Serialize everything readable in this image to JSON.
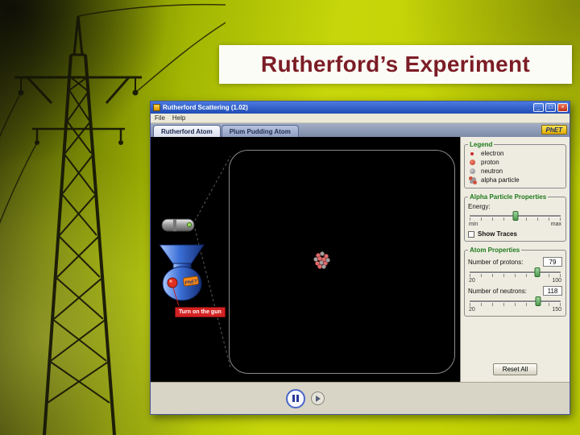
{
  "slide": {
    "title": "Rutherford’s Experiment"
  },
  "window": {
    "title": "Rutherford Scattering (1.02)",
    "controls": {
      "minimize": "_",
      "maximize": "□",
      "close": "×"
    },
    "menu": {
      "file": "File",
      "help": "Help"
    },
    "tabs": {
      "rutherford": "Rutherford Atom",
      "plum_pudding": "Plum Pudding Atom"
    },
    "logo_text": "PhET"
  },
  "canvas": {
    "gun_button_label": "Turn on the gun",
    "gun_sticker": "PhET"
  },
  "panels": {
    "legend": {
      "title": "Legend",
      "items": [
        {
          "label": "electron",
          "color": "#cc2a2a"
        },
        {
          "label": "proton",
          "color": "#d94f3c"
        },
        {
          "label": "neutron",
          "color": "#9a9a9a"
        },
        {
          "label": "alpha particle",
          "color": "#d97a7a"
        }
      ]
    },
    "alpha": {
      "title": "Alpha Particle Properties",
      "energy_label": "Energy:",
      "min_label": "min",
      "max_label": "max",
      "energy_percent": 50,
      "show_traces_label": "Show Traces",
      "show_traces_checked": false
    },
    "atom": {
      "title": "Atom Properties",
      "protons_label": "Number of protons:",
      "protons_value": "79",
      "protons_percent": 74,
      "protons_min": "20",
      "protons_max": "100",
      "neutrons_label": "Number of neutrons:",
      "neutrons_value": "118",
      "neutrons_percent": 75,
      "neutrons_min": "20",
      "neutrons_max": "150"
    },
    "reset_label": "Reset All"
  },
  "colors": {
    "slide_title_text": "#7c1d26",
    "titlebar_blue": "#2a55c0",
    "canvas_bg": "#000000",
    "panel_bg": "#eeece0",
    "gun_button_red": "#d42222",
    "panel_title_green": "#1e7a1e"
  }
}
